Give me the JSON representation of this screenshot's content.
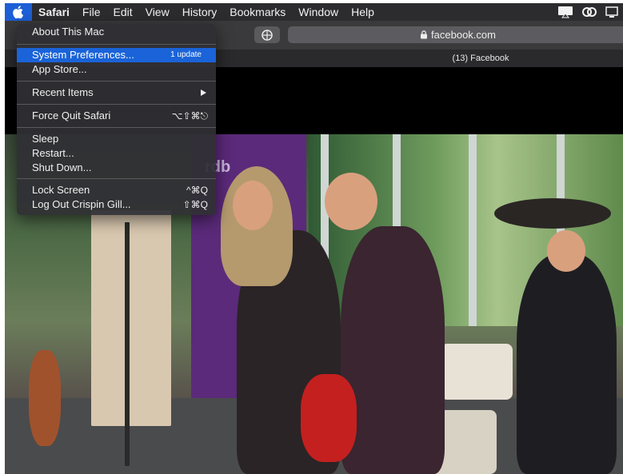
{
  "menubar": {
    "items": [
      "Safari",
      "File",
      "Edit",
      "View",
      "History",
      "Bookmarks",
      "Window",
      "Help"
    ]
  },
  "toolbar": {
    "url": "facebook.com"
  },
  "tab": {
    "title": "(13) Facebook"
  },
  "apple_menu": {
    "about": "About This Mac",
    "system_prefs": "System Preferences...",
    "system_prefs_badge": "1 update",
    "app_store": "App Store...",
    "recent_items": "Recent Items",
    "force_quit": "Force Quit Safari",
    "force_quit_shortcut": "⌥⇧⌘⎋",
    "sleep": "Sleep",
    "restart": "Restart...",
    "shut_down": "Shut Down...",
    "lock_screen": "Lock Screen",
    "lock_screen_shortcut": "^⌘Q",
    "log_out": "Log Out Crispin Gill...",
    "log_out_shortcut": "⇧⌘Q"
  },
  "video": {
    "banner_text": "rdb"
  },
  "colors": {
    "menu_highlight": "#1a63d8",
    "menubar_bg": "#2c2c2e"
  }
}
